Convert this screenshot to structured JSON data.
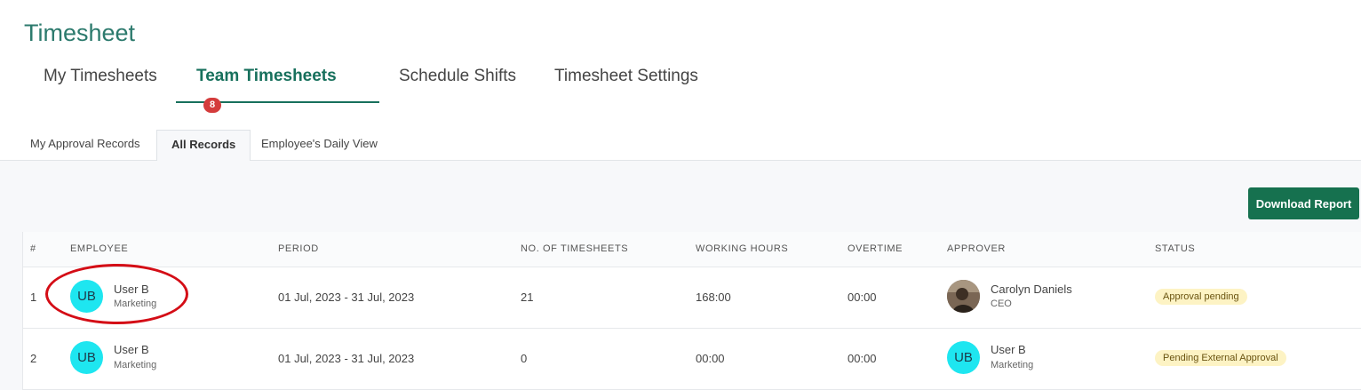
{
  "page": {
    "title": "Timesheet"
  },
  "main_tabs": [
    {
      "label": "My Timesheets"
    },
    {
      "label": "Team Timesheets",
      "badge": "8"
    },
    {
      "label": "Schedule Shifts"
    },
    {
      "label": "Timesheet Settings"
    }
  ],
  "sub_tabs": [
    {
      "label": "My Approval Records"
    },
    {
      "label": "All Records"
    },
    {
      "label": "Employee's Daily View"
    }
  ],
  "toolbar": {
    "download_label": "Download Report"
  },
  "table": {
    "headers": [
      "#",
      "EMPLOYEE",
      "PERIOD",
      "NO. OF TIMESHEETS",
      "WORKING HOURS",
      "OVERTIME",
      "APPROVER",
      "STATUS"
    ],
    "rows": [
      {
        "index": "1",
        "employee": {
          "initials": "UB",
          "name": "User B",
          "dept": "Marketing"
        },
        "period": "01 Jul, 2023 - 31 Jul, 2023",
        "timesheets": "21",
        "working_hours": "168:00",
        "overtime": "00:00",
        "approver": {
          "initials": "",
          "name": "Carolyn Daniels",
          "role": "CEO",
          "has_photo": true
        },
        "status": "Approval pending"
      },
      {
        "index": "2",
        "employee": {
          "initials": "UB",
          "name": "User B",
          "dept": "Marketing"
        },
        "period": "01 Jul, 2023 - 31 Jul, 2023",
        "timesheets": "0",
        "working_hours": "00:00",
        "overtime": "00:00",
        "approver": {
          "initials": "UB",
          "name": "User B",
          "role": "Marketing",
          "has_photo": false
        },
        "status": "Pending External Approval"
      }
    ]
  },
  "colors": {
    "accent": "#17705c",
    "button": "#16714f",
    "badge": "#d43c3c",
    "avatar": "#1ee6f0",
    "status_bg": "#fdf3c4",
    "annotation": "#d40d16"
  }
}
